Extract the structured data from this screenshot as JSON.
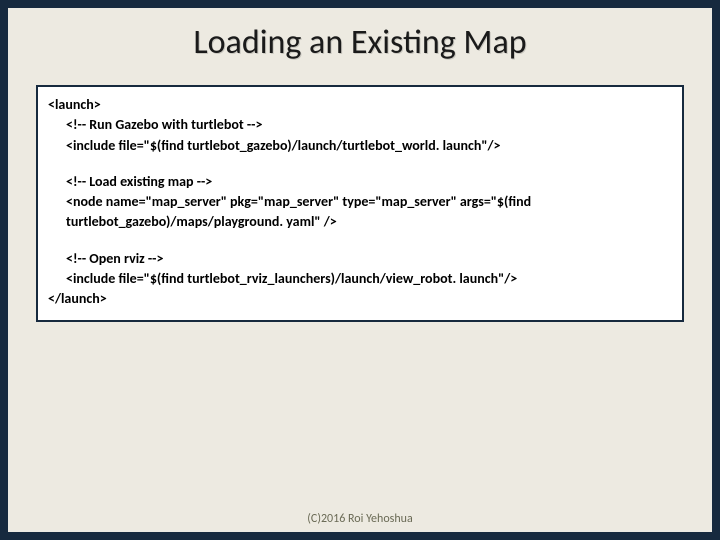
{
  "title": "Loading an Existing Map",
  "code": {
    "l1": "<launch>",
    "l2": "<!-- Run Gazebo with turtlebot -->",
    "l3": "<include file=\"$(find turtlebot_gazebo)/launch/turtlebot_world. launch\"/>",
    "l4": "<!-- Load existing map -->",
    "l5": "<node name=\"map_server\" pkg=\"map_server\" type=\"map_server\" args=\"$(find turtlebot_gazebo)/maps/playground. yaml\" />",
    "l6": "<!-- Open rviz -->",
    "l7": "<include file=\"$(find turtlebot_rviz_launchers)/launch/view_robot. launch\"/>",
    "l8": "</launch>"
  },
  "footer": "(C)2016 Roi Yehoshua"
}
